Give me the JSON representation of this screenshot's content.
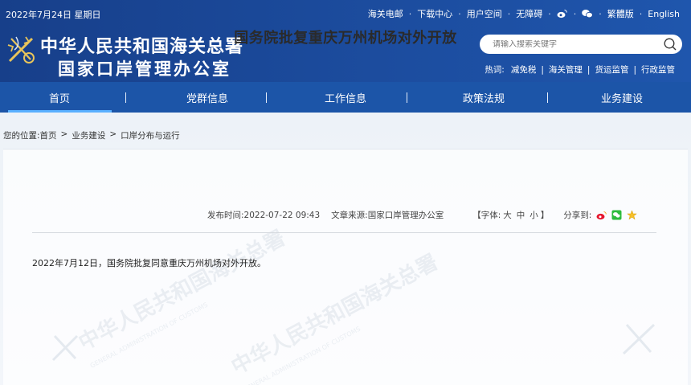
{
  "header": {
    "date": "2022年7月24日 星期日",
    "toplinks": [
      "海关电邮",
      "下载中心",
      "用户空间",
      "无障碍"
    ],
    "lang": [
      "繁體版",
      "English"
    ],
    "logo_line1": "中华人民共和国海关总署",
    "logo_line2": "国家口岸管理办公室",
    "search_placeholder": "请输入搜索关键字",
    "hot_label": "热词:",
    "hot_words": [
      "减免税",
      "海关管理",
      "货运监管",
      "行政监管"
    ]
  },
  "nav": {
    "items": [
      "首页",
      "党群信息",
      "工作信息",
      "政策法规",
      "业务建设"
    ],
    "active": 0
  },
  "breadcrumb": {
    "prefix": "您的位置:",
    "items": [
      "首页",
      "业务建设",
      "口岸分布与运行"
    ]
  },
  "article": {
    "title": "国务院批复重庆万州机场对外开放",
    "publish_label": "发布时间:",
    "publish_time": "2022-07-22 09:43",
    "source_label": "文章来源:",
    "source": "国家口岸管理办公室",
    "font_label": "【字体:",
    "font_sizes": [
      "大",
      "中",
      "小"
    ],
    "font_close": "】",
    "share_label": "分享到:",
    "body": "2022年7月12日，国务院批复同意重庆万州机场对外开放。"
  },
  "watermark": {
    "text_cn": "中华人民共和国海关总署",
    "text_en": "GENERAL ADMINISTRATION OF CUSTOMS"
  },
  "colors": {
    "header_bg": "#1b4a9b",
    "nav_bg": "#1c55a8",
    "nav_active_underline": "#5ab0ff"
  }
}
